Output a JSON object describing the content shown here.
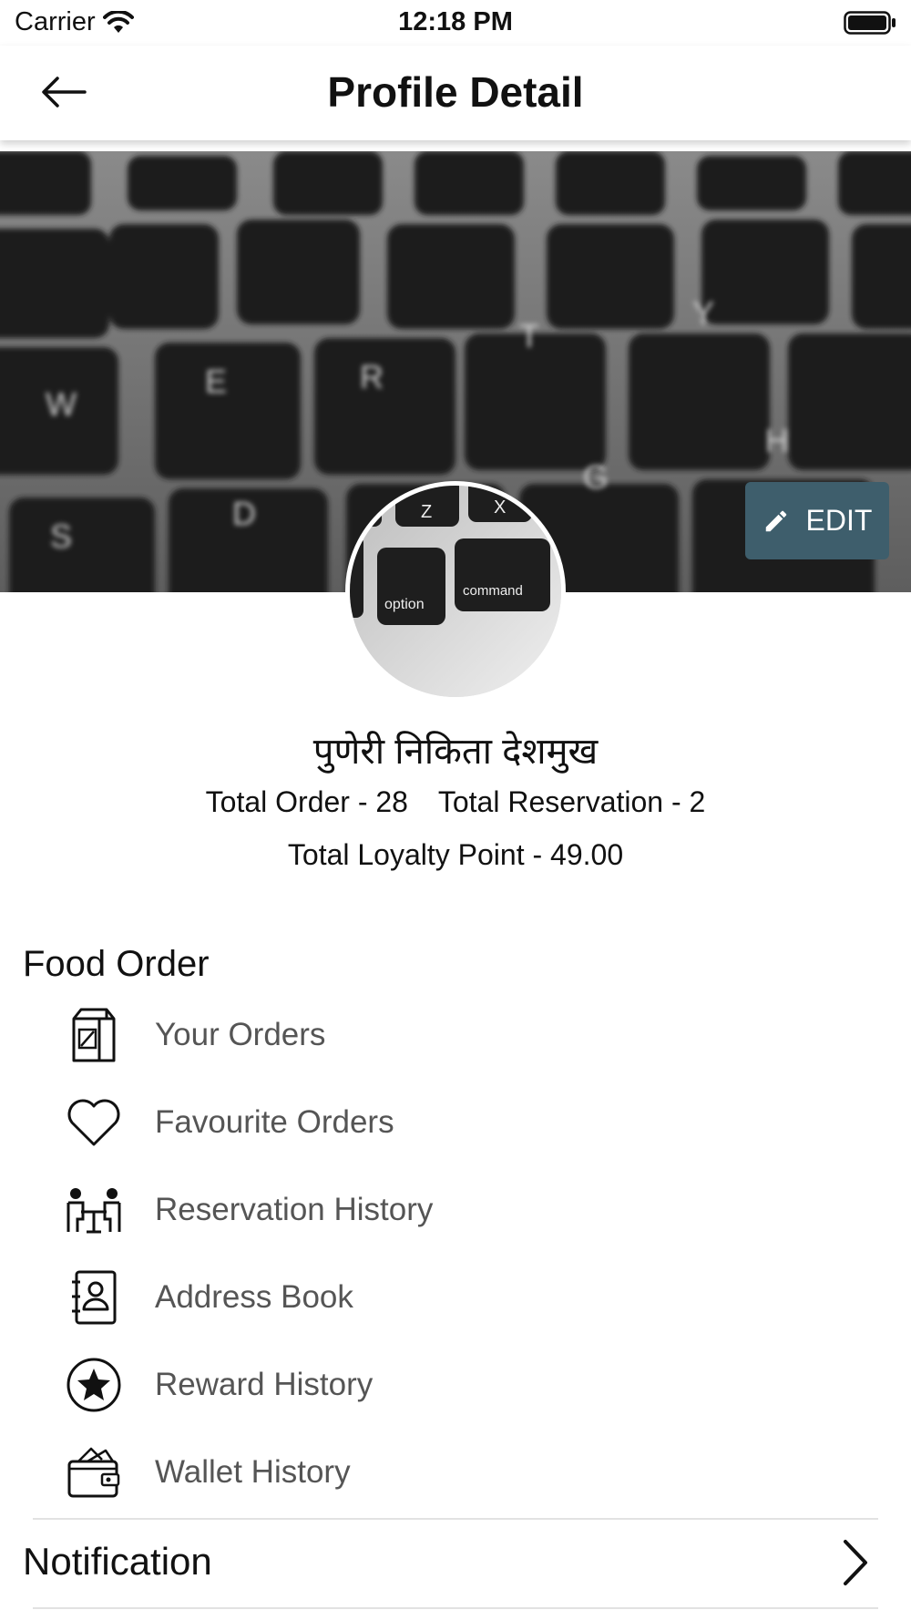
{
  "status_bar": {
    "carrier": "Carrier",
    "time": "12:18 PM"
  },
  "header": {
    "title": "Profile Detail"
  },
  "cover": {
    "edit_label": "EDIT",
    "accent": "#3e5e6c"
  },
  "profile": {
    "name": "पुणेरी निकिता देशमुख",
    "total_order": "Total Order - 28",
    "total_reservation": "Total Reservation - 2",
    "loyalty": "Total Loyalty Point - 49.00"
  },
  "food_order": {
    "title": "Food Order",
    "items": [
      {
        "label": "Your Orders",
        "icon": "order-bag-icon"
      },
      {
        "label": "Favourite Orders",
        "icon": "heart-icon"
      },
      {
        "label": "Reservation History",
        "icon": "dining-table-icon"
      },
      {
        "label": "Address Book",
        "icon": "address-book-icon"
      },
      {
        "label": "Reward History",
        "icon": "star-badge-icon"
      },
      {
        "label": "Wallet History",
        "icon": "wallet-icon"
      }
    ]
  },
  "notification": {
    "label": "Notification",
    "icon": "chevron-right-icon"
  }
}
